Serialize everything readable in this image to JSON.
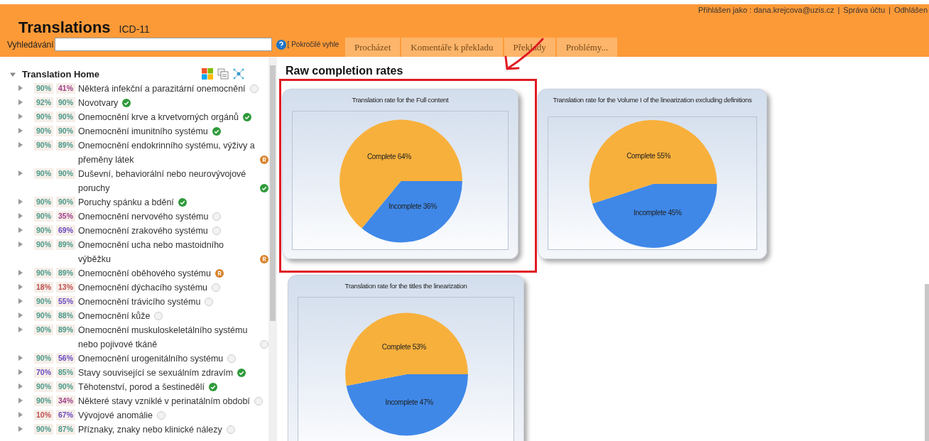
{
  "header": {
    "title": "Translations",
    "subtitle": "ICD-11",
    "user_links": [
      "Přihlášen jako : dana.krejcova@uzis.cz",
      "|",
      "Správa účtu",
      "|",
      "Odhlášen"
    ],
    "search": {
      "label": "Vyhledávání"
    },
    "advanced_link": "[ Pokročilé vyhle"
  },
  "tabs": [
    {
      "label": "Procházet",
      "selected": false
    },
    {
      "label": "Komentáře k překladu",
      "selected": false
    },
    {
      "label": "Překlady",
      "selected": false
    },
    {
      "label": "Problémy...",
      "selected": false
    }
  ],
  "tree": {
    "label": "Translation Home",
    "expanded": true,
    "children": [
      {
        "label": "Některá infekční a parazitární onemocnění",
        "rates": [
          {
            "text": "90%",
            "color": "#4a9a8a"
          },
          {
            "text": "41%",
            "color": "#a0408a"
          }
        ],
        "kind": "none"
      },
      {
        "label": "Novotvary",
        "rates": [
          {
            "text": "92%",
            "color": "#4a9a8a"
          },
          {
            "text": "90%",
            "color": "#4a9a8a"
          }
        ],
        "kind": "done"
      },
      {
        "label": "Onemocnění krve a krvetvorných orgánů",
        "rates": [
          {
            "text": "90%",
            "color": "#4a9a8a"
          },
          {
            "text": "90%",
            "color": "#4a9a8a"
          }
        ],
        "kind": "done"
      },
      {
        "label": "Onemocnění imunitního systému",
        "rates": [
          {
            "text": "90%",
            "color": "#4a9a8a"
          },
          {
            "text": "90%",
            "color": "#4a9a8a"
          }
        ],
        "kind": "done"
      },
      {
        "label": "Onemocnění endokrinního systému, výživy a přeměny látek",
        "rates": [
          {
            "text": "90%",
            "color": "#4a9a8a"
          },
          {
            "text": "89%",
            "color": "#4a9a8a"
          }
        ],
        "kind": "review"
      },
      {
        "label": "Duševní, behaviorální nebo neurovývojové poruchy",
        "rates": [
          {
            "text": "90%",
            "color": "#4a9a8a"
          },
          {
            "text": "90%",
            "color": "#4a9a8a"
          }
        ],
        "kind": "done"
      },
      {
        "label": "Poruchy spánku a bdění",
        "rates": [
          {
            "text": "90%",
            "color": "#4a9a8a"
          },
          {
            "text": "90%",
            "color": "#4a9a8a"
          }
        ],
        "kind": "done"
      },
      {
        "label": "Onemocnění nervového systému",
        "rates": [
          {
            "text": "90%",
            "color": "#4a9a8a"
          },
          {
            "text": "35%",
            "color": "#a0408a"
          }
        ],
        "kind": "none"
      },
      {
        "label": "Onemocnění zrakového systému",
        "rates": [
          {
            "text": "90%",
            "color": "#4a9a8a"
          },
          {
            "text": "69%",
            "color": "#6a4ac0"
          }
        ],
        "kind": "none"
      },
      {
        "label": "Onemocnění ucha nebo mastoidního výběžku",
        "rates": [
          {
            "text": "90%",
            "color": "#4a9a8a"
          },
          {
            "text": "89%",
            "color": "#4a9a8a"
          }
        ],
        "kind": "review"
      },
      {
        "label": "Onemocnění oběhového systému",
        "rates": [
          {
            "text": "90%",
            "color": "#4a9a8a"
          },
          {
            "text": "89%",
            "color": "#4a9a8a"
          }
        ],
        "kind": "review"
      },
      {
        "label": "Onemocnění dýchacího systému",
        "rates": [
          {
            "text": "18%",
            "color": "#c05050"
          },
          {
            "text": "13%",
            "color": "#c05050"
          }
        ],
        "kind": "none"
      },
      {
        "label": "Onemocnění trávicího systému",
        "rates": [
          {
            "text": "90%",
            "color": "#4a9a8a"
          },
          {
            "text": "55%",
            "color": "#6a4ac0"
          }
        ],
        "kind": "none"
      },
      {
        "label": "Onemocnění kůže",
        "rates": [
          {
            "text": "90%",
            "color": "#4a9a8a"
          },
          {
            "text": "88%",
            "color": "#4a9a8a"
          }
        ],
        "kind": "none"
      },
      {
        "label": "Onemocnění muskuloskeletálního systému nebo pojivové tkáně",
        "rates": [
          {
            "text": "90%",
            "color": "#4a9a8a"
          },
          {
            "text": "89%",
            "color": "#4a9a8a"
          }
        ],
        "kind": "none"
      },
      {
        "label": "Onemocnění urogenitálního systému",
        "rates": [
          {
            "text": "90%",
            "color": "#4a9a8a"
          },
          {
            "text": "56%",
            "color": "#6a4ac0"
          }
        ],
        "kind": "none"
      },
      {
        "label": "Stavy související se sexuálním zdravím",
        "rates": [
          {
            "text": "70%",
            "color": "#6a4ac0"
          },
          {
            "text": "85%",
            "color": "#4a9a8a"
          }
        ],
        "kind": "done"
      },
      {
        "label": "Těhotenství, porod a šestinedělí",
        "rates": [
          {
            "text": "90%",
            "color": "#4a9a8a"
          },
          {
            "text": "90%",
            "color": "#4a9a8a"
          }
        ],
        "kind": "done"
      },
      {
        "label": "Některé stavy vzniklé v perinatálním období",
        "rates": [
          {
            "text": "90%",
            "color": "#4a9a8a"
          },
          {
            "text": "34%",
            "color": "#a0408a"
          }
        ],
        "kind": "none"
      },
      {
        "label": "Vývojové anomálie",
        "rates": [
          {
            "text": "10%",
            "color": "#c05050"
          },
          {
            "text": "67%",
            "color": "#6a4ac0"
          }
        ],
        "kind": "none"
      },
      {
        "label": "Příznaky, znaky nebo klinické nálezy",
        "rates": [
          {
            "text": "90%",
            "color": "#4a9a8a"
          },
          {
            "text": "87%",
            "color": "#4a9a8a"
          }
        ],
        "kind": "none"
      }
    ]
  },
  "main": {
    "heading": "Raw completion rates",
    "charts": [
      {
        "title": "Translation rate for the Full content",
        "chart_data": {
          "type": "pie",
          "categories": [
            "Complete",
            "Incomplete"
          ],
          "values": [
            64,
            36
          ],
          "colors": [
            "#f8b03c",
            "#3f88e8"
          ],
          "value_labels": [
            "64%",
            "36%"
          ]
        }
      },
      {
        "title": "Translation rate for the Volume I of the linearization excluding definitions",
        "chart_data": {
          "type": "pie",
          "categories": [
            "Complete",
            "Incomplete"
          ],
          "values": [
            55,
            45
          ],
          "colors": [
            "#f8b03c",
            "#3f88e8"
          ],
          "value_labels": [
            "55%",
            "45%"
          ]
        }
      },
      {
        "title": "Translation rate for the titles the linearization",
        "chart_data": {
          "type": "pie",
          "categories": [
            "Complete",
            "Incomplete"
          ],
          "values": [
            53,
            47
          ],
          "colors": [
            "#f8b03c",
            "#3f88e8"
          ],
          "value_labels": [
            "53%",
            "47%"
          ]
        }
      }
    ]
  }
}
